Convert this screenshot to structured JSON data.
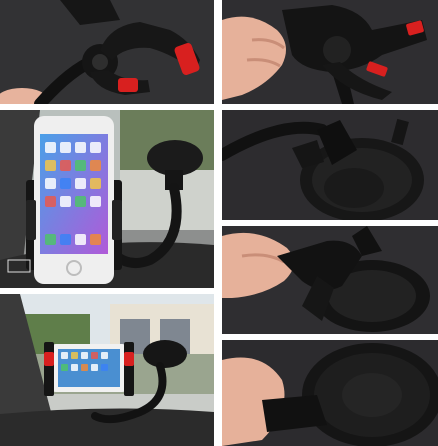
{
  "collage": {
    "panels": [
      {
        "id": "t1",
        "subject": "phone-clamp-arms-closeup"
      },
      {
        "id": "t2",
        "subject": "hand-pressing-clamp-release"
      },
      {
        "id": "t3",
        "subject": "phone-mounted-on-windshield"
      },
      {
        "id": "t4",
        "subject": "suction-cup-base-lever"
      },
      {
        "id": "t5",
        "subject": "hand-locking-suction-lever"
      },
      {
        "id": "t6",
        "subject": "phone-mounted-dashboard-outdoor-view"
      },
      {
        "id": "t7",
        "subject": "suction-cup-underside"
      }
    ],
    "colors": {
      "background": "#ffffff",
      "holder_black": "#151515",
      "grip_red": "#d8201f",
      "skin": "#e9b7a0",
      "phone_white": "#f2f2f2"
    }
  }
}
